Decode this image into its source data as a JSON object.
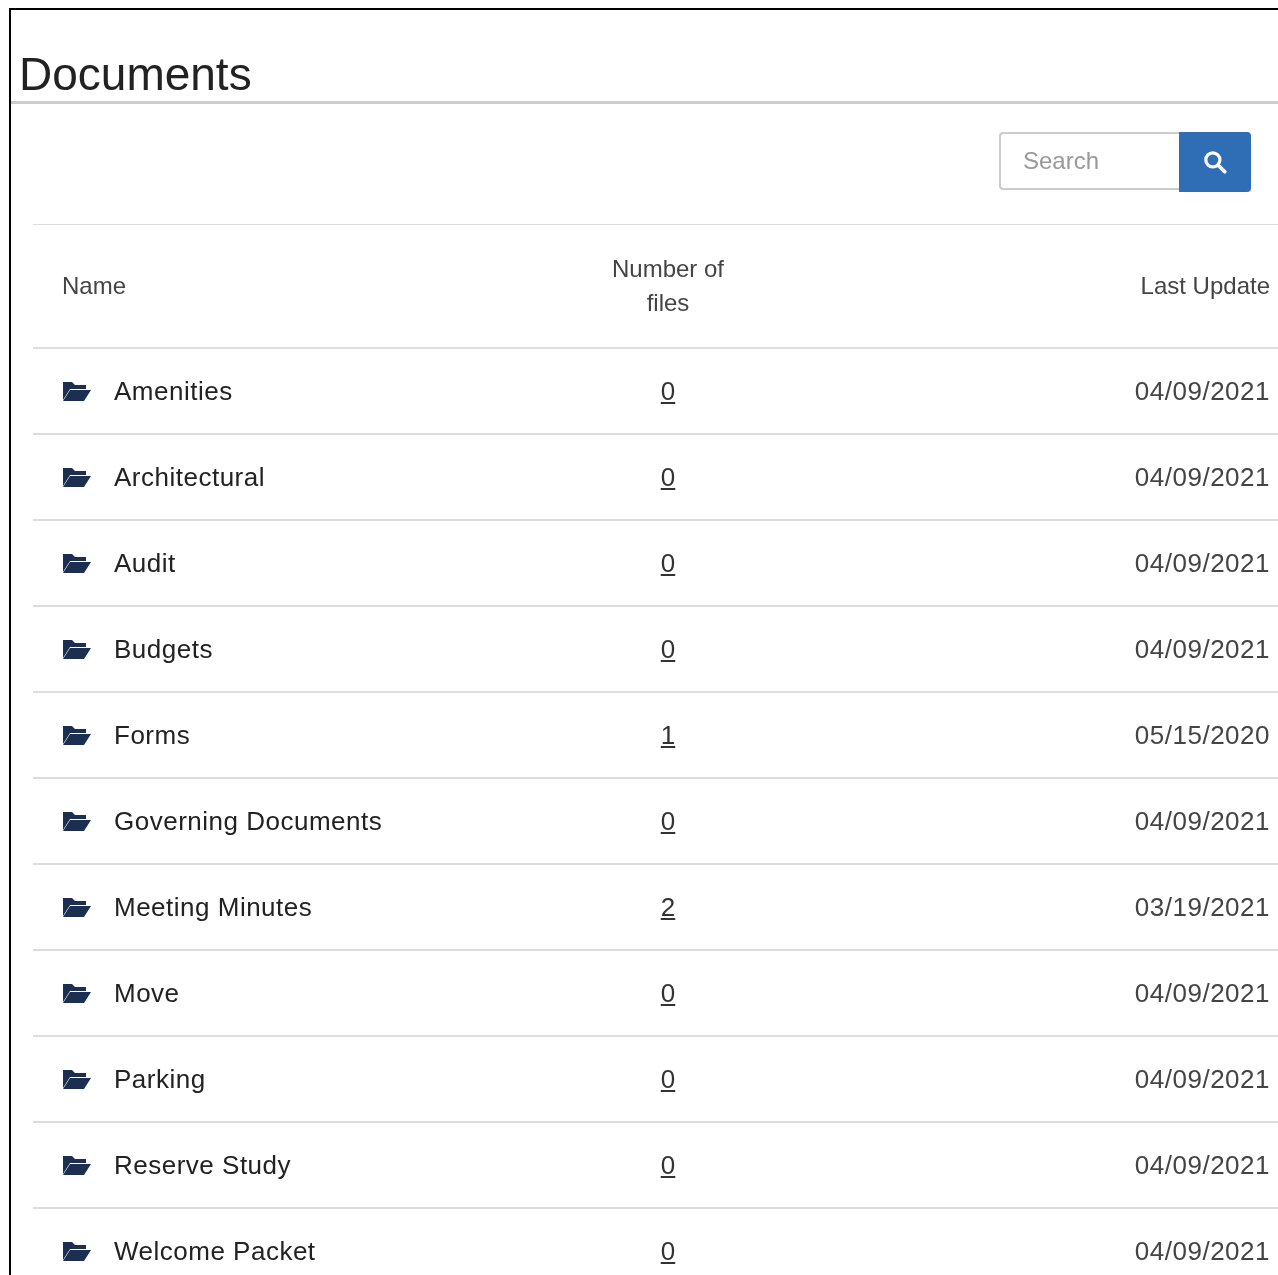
{
  "title": "Documents",
  "search": {
    "placeholder": "Search"
  },
  "table": {
    "columns": [
      "Name",
      "Number of files",
      "Last Update"
    ],
    "rows": [
      {
        "name": "Amenities",
        "files": "0",
        "updated": "04/09/2021"
      },
      {
        "name": "Architectural",
        "files": "0",
        "updated": "04/09/2021"
      },
      {
        "name": "Audit",
        "files": "0",
        "updated": "04/09/2021"
      },
      {
        "name": "Budgets",
        "files": "0",
        "updated": "04/09/2021"
      },
      {
        "name": "Forms",
        "files": "1",
        "updated": "05/15/2020"
      },
      {
        "name": "Governing Documents",
        "files": "0",
        "updated": "04/09/2021"
      },
      {
        "name": "Meeting Minutes",
        "files": "2",
        "updated": "03/19/2021"
      },
      {
        "name": "Move",
        "files": "0",
        "updated": "04/09/2021"
      },
      {
        "name": "Parking",
        "files": "0",
        "updated": "04/09/2021"
      },
      {
        "name": "Reserve Study",
        "files": "0",
        "updated": "04/09/2021"
      },
      {
        "name": "Welcome Packet",
        "files": "0",
        "updated": "04/09/2021"
      }
    ]
  }
}
